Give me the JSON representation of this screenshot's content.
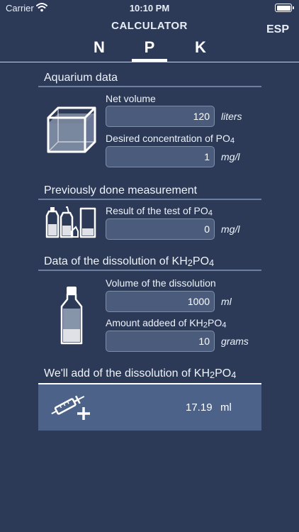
{
  "status_bar": {
    "carrier": "Carrier",
    "time": "10:10 PM"
  },
  "nav": {
    "title": "CALCULATOR",
    "lang_button": "ESP"
  },
  "tabs": [
    {
      "label": "N",
      "selected": false
    },
    {
      "label": "P",
      "selected": true
    },
    {
      "label": "K",
      "selected": false
    }
  ],
  "aquarium": {
    "title": "Aquarium data",
    "net_volume_label": "Net volume",
    "net_volume_value": "120",
    "net_volume_unit": "liters",
    "desired_label": "Desired concentration of PO4",
    "desired_value": "1",
    "desired_unit": "mg/l"
  },
  "measurement": {
    "title": "Previously done measurement",
    "result_label": "Result of the test of PO4",
    "result_value": "0",
    "result_unit": "mg/l"
  },
  "dissolution": {
    "title": "Data of the dissolution of KH2PO4",
    "volume_label": "Volume of the dissolution",
    "volume_value": "1000",
    "volume_unit": "ml",
    "amount_label": "Amount addeed of KH2PO4",
    "amount_value": "10",
    "amount_unit": "grams"
  },
  "result": {
    "title": "We'll add of the dissolution of KH2PO4",
    "value": "17.19",
    "unit": "ml"
  },
  "colors": {
    "background": "#2c3a58",
    "input_bg": "#4a5b7c",
    "result_bg": "#4d6288"
  }
}
